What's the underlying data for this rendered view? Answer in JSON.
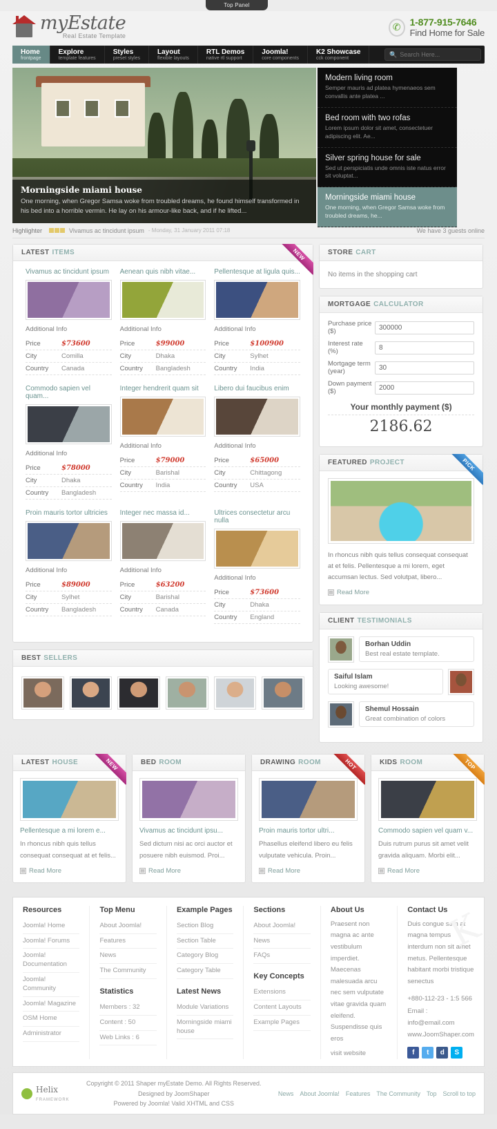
{
  "top_panel": {
    "label": "Top Panel"
  },
  "header": {
    "logo_name": "myEstate",
    "logo_sub": "Real Estate Template",
    "phone": "1-877-915-7646",
    "tagline": "Find Home for Sale"
  },
  "nav": {
    "items": [
      {
        "title": "Home",
        "desc": "frontpage",
        "active": true
      },
      {
        "title": "Explore",
        "desc": "template features",
        "active": false
      },
      {
        "title": "Styles",
        "desc": "preset styles",
        "active": false
      },
      {
        "title": "Layout",
        "desc": "flexible layouts",
        "active": false
      },
      {
        "title": "RTL Demos",
        "desc": "native rtl support",
        "active": false
      },
      {
        "title": "Joomla!",
        "desc": "core components",
        "active": false
      },
      {
        "title": "K2 Showcase",
        "desc": "cck component",
        "active": false
      }
    ],
    "search_placeholder": "Search Here...",
    "search_value": ""
  },
  "slider": {
    "caption_title": "Morningside miami house",
    "caption_text": "One morning, when Gregor Samsa woke from troubled dreams, he found himself transformed in his bed into a horrible vermin. He lay on his armour-like back, and if he lifted...",
    "items": [
      {
        "title": "Modern living room",
        "text": "Semper mauris ad platea hymenaeos sem convallis ante platea ...",
        "active": false
      },
      {
        "title": "Bed room with two rofas",
        "text": "Lorem ipsum dolor sit amet, consectetuer adipiscing elit. Ae...",
        "active": false
      },
      {
        "title": "Silver spring house for sale",
        "text": "Sed ut perspiciatis unde omnis iste natus error sit voluptat...",
        "active": false
      },
      {
        "title": "Morningside miami house",
        "text": "One morning, when Gregor Samsa woke from troubled dreams, he...",
        "active": true
      }
    ]
  },
  "highlighter": {
    "label": "Highlighter",
    "title": "Vivamus ac tincidunt ipsum",
    "date": "- Monday, 31 January 2011 07:18",
    "guests": "We have 3 guests online"
  },
  "latest_items": {
    "head_bold": "LATEST",
    "head_light": "ITEMS",
    "ribbon": "NEW",
    "labels": {
      "additional": "Additional Info",
      "price": "Price",
      "city": "City",
      "country": "Country"
    },
    "items": [
      {
        "title": "Vivamus ac tincidunt ipsum",
        "price": "$73600",
        "city": "Comilla",
        "country": "Canada",
        "c1": "#8f6fa0",
        "c2": "#b79ec4"
      },
      {
        "title": "Aenean quis nibh vitae...",
        "price": "$99000",
        "city": "Dhaka",
        "country": "Bangladesh",
        "c1": "#93a53a",
        "c2": "#e8ead8"
      },
      {
        "title": "Pellentesque at ligula quis...",
        "price": "$100900",
        "city": "Sylhet",
        "country": "India",
        "c1": "#3c5080",
        "c2": "#cfa77e"
      },
      {
        "title": "Commodo sapien vel quam...",
        "price": "$78000",
        "city": "Dhaka",
        "country": "Bangladesh",
        "c1": "#3b3f47",
        "c2": "#9ba6a8"
      },
      {
        "title": "Integer hendrerit quam sit",
        "price": "$79000",
        "city": "Barishal",
        "country": "India",
        "c1": "#a9794a",
        "c2": "#ede4d4"
      },
      {
        "title": "Libero dui faucibus enim",
        "price": "$65000",
        "city": "Chittagong",
        "country": "USA",
        "c1": "#58463a",
        "c2": "#ddd4c6"
      },
      {
        "title": "Proin mauris tortor ultricies",
        "price": "$89000",
        "city": "Sylhet",
        "country": "Bangladesh",
        "c1": "#4a5e86",
        "c2": "#b59b7c"
      },
      {
        "title": "Integer nec massa id...",
        "price": "$63200",
        "city": "Barishal",
        "country": "Canada",
        "c1": "#8d8173",
        "c2": "#e4ded3"
      },
      {
        "title": "Ultrices consectetur arcu nulla",
        "price": "$73600",
        "city": "Dhaka",
        "country": "England",
        "c1": "#b98f4e",
        "c2": "#e6cb9a"
      }
    ]
  },
  "best_sellers": {
    "head_bold": "BEST",
    "head_light": "SELLERS",
    "people": [
      {
        "name": "seller-1",
        "skin": "#d5a07c",
        "bg": "#7b6a5c"
      },
      {
        "name": "seller-2",
        "skin": "#d9a884",
        "bg": "#3c4450"
      },
      {
        "name": "seller-3",
        "skin": "#cf9b76",
        "bg": "#2c2c30"
      },
      {
        "name": "seller-4",
        "skin": "#c99470",
        "bg": "#9fb0a2"
      },
      {
        "name": "seller-5",
        "skin": "#dbae8a",
        "bg": "#cfd4d8"
      },
      {
        "name": "seller-6",
        "skin": "#c68f68",
        "bg": "#6d7b86"
      }
    ]
  },
  "store_cart": {
    "head_bold": "STORE",
    "head_light": "CART",
    "empty_text": "No items in the shopping cart"
  },
  "mortgage": {
    "head_bold": "MORTGAGE",
    "head_light": "CALCULATOR",
    "fields": [
      {
        "label": "Purchase price ($)",
        "value": "300000"
      },
      {
        "label": "Interest rate (%)",
        "value": "8"
      },
      {
        "label": "Mortgage term (year)",
        "value": "30"
      },
      {
        "label": "Down payment ($)",
        "value": "2000"
      }
    ],
    "payment_label": "Your monthly payment ($)",
    "payment_value": "2186.62"
  },
  "featured": {
    "head_bold": "FEATURED",
    "head_light": "PROJECT",
    "ribbon": "PICK",
    "text": "In rhoncus nibh quis tellus consequat consequat at et felis. Pellentesque a mi lorem, eget accumsan lectus. Sed volutpat, libero...",
    "read_more": "Read More"
  },
  "testimonials": {
    "head_bold": "CLIENT",
    "head_light": "TESTIMONIALS",
    "items": [
      {
        "name": "Borhan Uddin",
        "text": "Best real estate template.",
        "side": "left",
        "bg": "#9aa88c",
        "skin": "#7d5a3e"
      },
      {
        "name": "Saiful Islam",
        "text": "Looking awesome!",
        "side": "right",
        "bg": "#a6543e",
        "skin": "#7a5235"
      },
      {
        "name": "Shemul Hossain",
        "text": "Great combination of colors",
        "side": "left",
        "bg": "#5d6b78",
        "skin": "#6b4a31"
      }
    ]
  },
  "showcase": [
    {
      "head_bold": "LATEST",
      "head_light": "HOUSE",
      "ribbon": "NEW",
      "ribbon_class": "r-new",
      "title": "Pellentesque a mi lorem e...",
      "text": "In rhoncus nibh quis tellus consequat consequat at et felis...",
      "read_more": "Read More",
      "c1": "#57a7c4",
      "c2": "#cbb894"
    },
    {
      "head_bold": "BED",
      "head_light": "ROOM",
      "ribbon": "",
      "ribbon_class": "",
      "title": "Vivamus ac tincidunt ipsu...",
      "text": "Sed dictum nisi ac orci auctor et posuere nibh euismod. Proi...",
      "read_more": "Read More",
      "c1": "#9272a6",
      "c2": "#c6aec8"
    },
    {
      "head_bold": "DRAWING",
      "head_light": "ROOM",
      "ribbon": "HOT",
      "ribbon_class": "r-hot",
      "title": "Proin mauris tortor ultri...",
      "text": "Phasellus eleifend libero eu felis vulputate vehicula. Proin...",
      "read_more": "Read More",
      "c1": "#4a5e86",
      "c2": "#b59b7c"
    },
    {
      "head_bold": "KIDS",
      "head_light": "ROOM",
      "ribbon": "TOP",
      "ribbon_class": "r-top",
      "title": "Commodo sapien vel quam v...",
      "text": "Duis rutrum purus sit amet velit gravida aliquam. Morbi elit...",
      "read_more": "Read More",
      "c1": "#3b3f47",
      "c2": "#c0a050"
    }
  ],
  "footer": {
    "columns": [
      {
        "title": "Resources",
        "links": [
          "Joomla! Home",
          "Joomla! Forums",
          "Joomla! Documentation",
          "Joomla! Community",
          "Joomla! Magazine",
          "OSM Home",
          "Administrator"
        ]
      },
      {
        "title": "Top Menu",
        "links": [
          "About Joomla!",
          "Features",
          "News",
          "The Community"
        ],
        "title2": "Statistics",
        "links2": [
          "Members : 32",
          "Content : 50",
          "Web Links : 6"
        ]
      },
      {
        "title": "Example Pages",
        "links": [
          "Section Blog",
          "Section Table",
          "Category Blog",
          "Category Table"
        ],
        "title2": "Latest News",
        "links2": [
          "Module Variations",
          "Morningside miami house"
        ]
      },
      {
        "title": "Sections",
        "links": [
          "About Joomla!",
          "News",
          "FAQs"
        ],
        "title2": "Key Concepts",
        "links2": [
          "Extensions",
          "Content Layouts",
          "Example Pages"
        ]
      }
    ],
    "about": {
      "title": "About Us",
      "text": "Praesent non magna ac ante vestibulum imperdiet. Maecenas malesuada arcu nec sem vulputate vitae gravida quam eleifend. Suspendisse quis eros",
      "link": "visit website"
    },
    "contact": {
      "title": "Contact Us",
      "text": "Duis congue sem at magna tempus interdum non sit amet metus. Pellentesque habitant morbi tristique senectus",
      "phone": "+880-112-23 - 1:5 566",
      "email": "Email : info@email.com",
      "web": "www.JoomShaper.com",
      "socials": [
        "f",
        "t",
        "d",
        "S"
      ]
    }
  },
  "bottom": {
    "helix_name": "Helix",
    "helix_sub": "FRAMEWORK",
    "copyright": "Copyright © 2011 Shaper myEstate Demo. All Rights Reserved. Designed by JoomShaper",
    "powered": "Powered by Joomla! Valid XHTML and CSS",
    "links": [
      "News",
      "About Joomla!",
      "Features",
      "The Community",
      "Top",
      "Scroll to top"
    ]
  }
}
